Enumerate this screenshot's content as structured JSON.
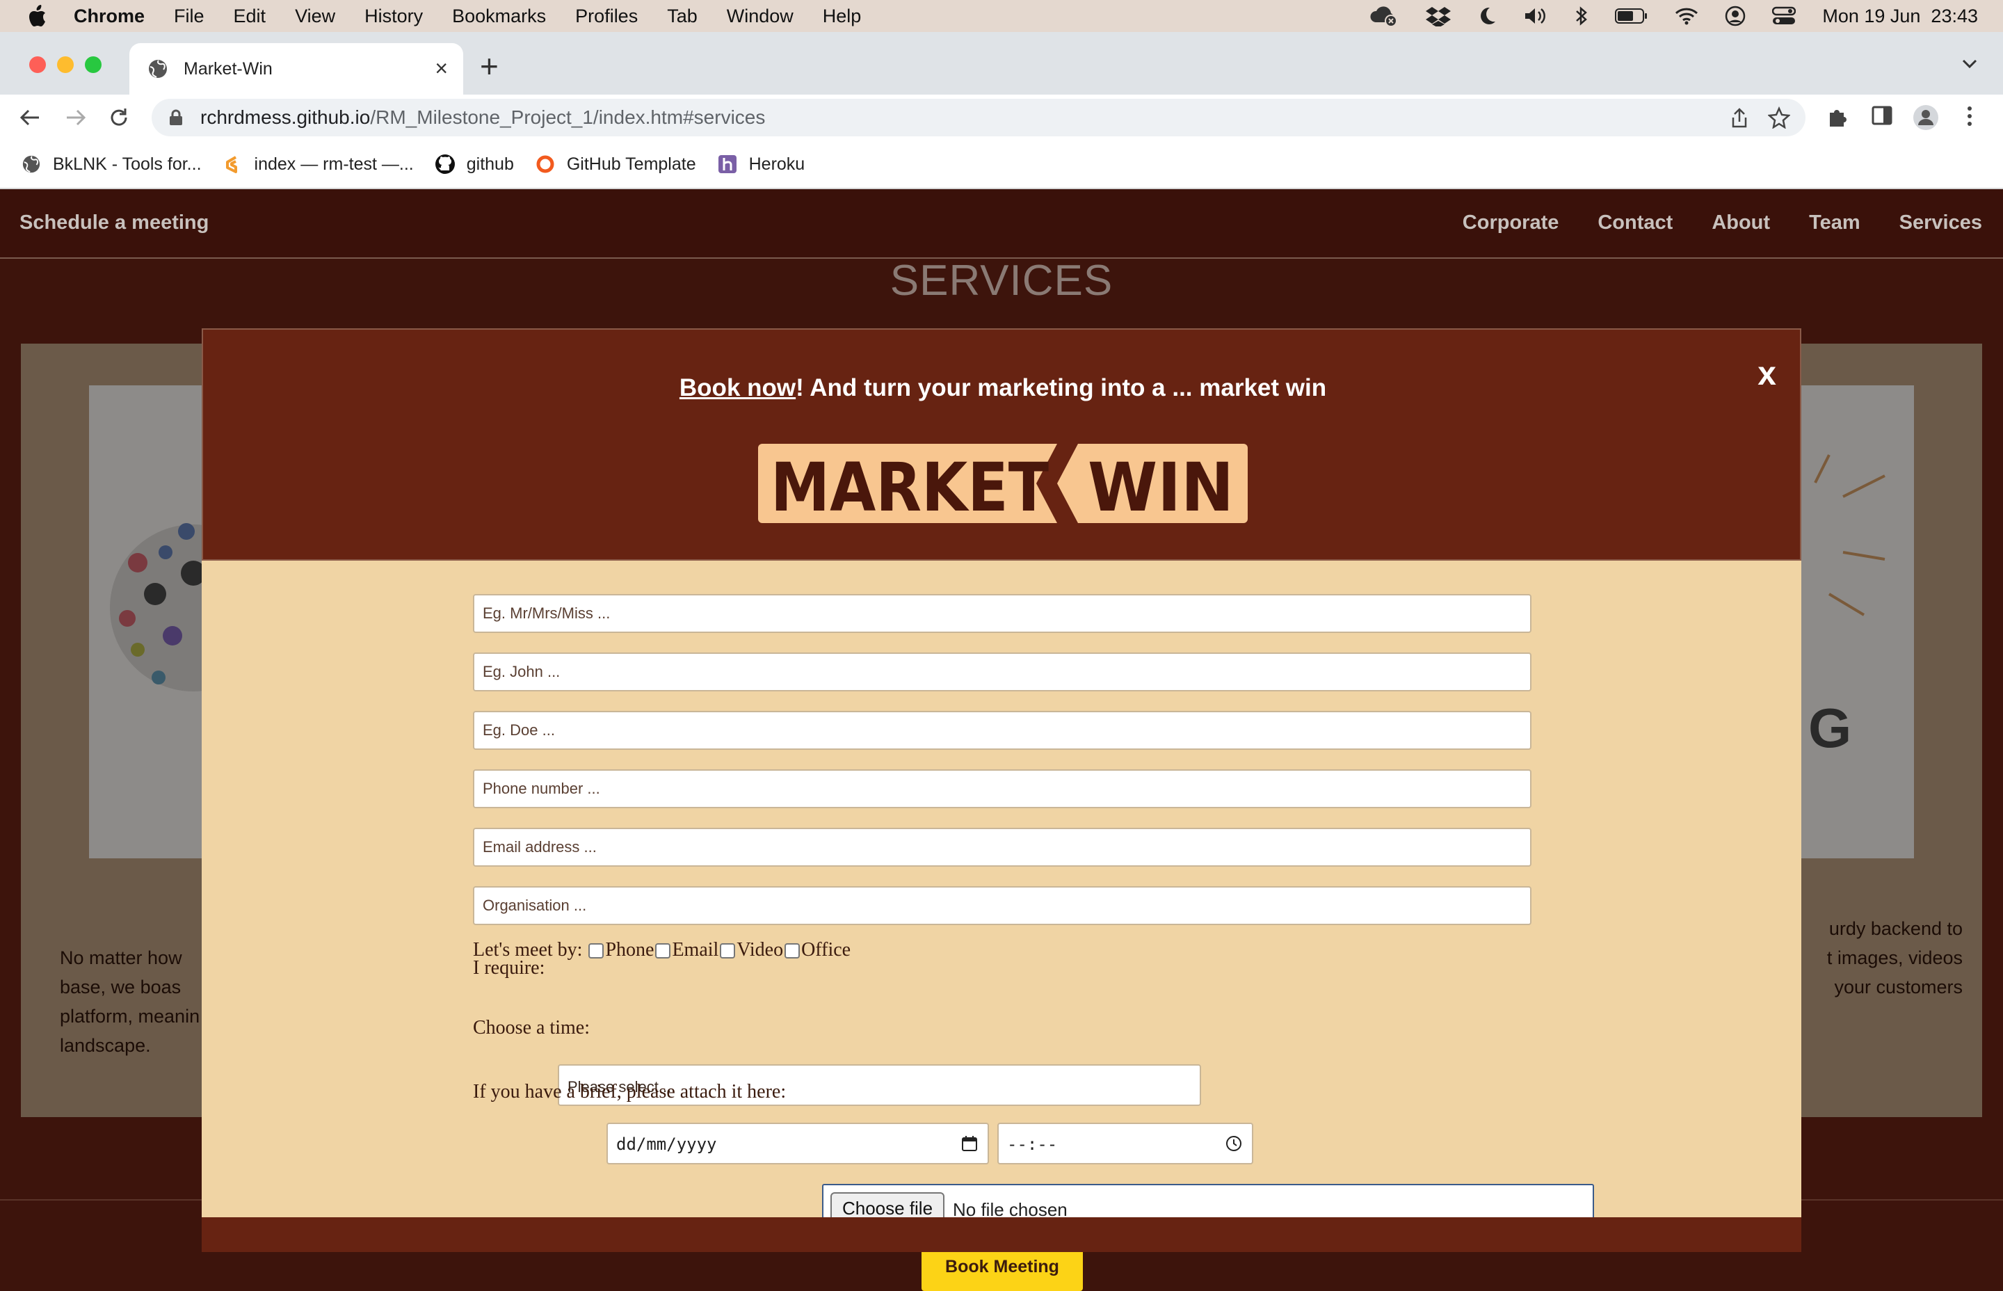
{
  "menubar": {
    "app": "Chrome",
    "items": [
      "File",
      "Edit",
      "View",
      "History",
      "Bookmarks",
      "Profiles",
      "Tab",
      "Window",
      "Help"
    ],
    "clock": "Mon 19 Jun  23:43"
  },
  "browser": {
    "tab_title": "Market-Win",
    "url_host": "rchrdmess.github.io",
    "url_path": "/RM_Milestone_Project_1/index.htm#services",
    "bookmarks": [
      {
        "label": "BkLNK - Tools for...",
        "icon": "globe-icon"
      },
      {
        "label": "index — rm-test —...",
        "icon": "gitpod-icon"
      },
      {
        "label": "github",
        "icon": "github-icon"
      },
      {
        "label": "GitHub Template",
        "icon": "ring-icon"
      },
      {
        "label": "Heroku",
        "icon": "heroku-icon"
      }
    ]
  },
  "site": {
    "brand": "Schedule a meeting",
    "nav": [
      "Corporate",
      "Contact",
      "About",
      "Team",
      "Services"
    ],
    "section_title": "SERVICES",
    "bg_left_text": [
      "No matter how",
      "base, we boas",
      "platform, meanin",
      "landscape."
    ],
    "bg_right_text": [
      "urdy backend to",
      "t images, videos",
      "your customers"
    ]
  },
  "modal": {
    "title_link": "Book now",
    "title_rest": "! And turn your marketing into a ... market win",
    "close": "x",
    "logo_text_left": "MARKET",
    "logo_text_right": "WIN",
    "fields": {
      "title": "Eg. Mr/Mrs/Miss ...",
      "first_name": "Eg. John ...",
      "last_name": "Eg. Doe ...",
      "phone": "Phone number ...",
      "email": "Email address ...",
      "organisation": "Organisation ..."
    },
    "meet_label": "Let's meet by:",
    "meet_options": [
      "Phone",
      "Email",
      "Video",
      "Office"
    ],
    "require_label": "I require:",
    "require_value": "Please select ...",
    "time_label": "Choose a time:",
    "date_value": "dd/mm/yyyy",
    "time_value": "--:--",
    "brief_label": "If you have a brief, please attach it here:",
    "file_button": "Choose file",
    "file_status": "No file chosen",
    "submit": "Book Meeting"
  },
  "colors": {
    "modal_header": "#672312",
    "modal_body": "#f0d4a4",
    "logo_fill": "#f8c690",
    "submit": "#fcd316",
    "page_bg": "#3d140c"
  }
}
